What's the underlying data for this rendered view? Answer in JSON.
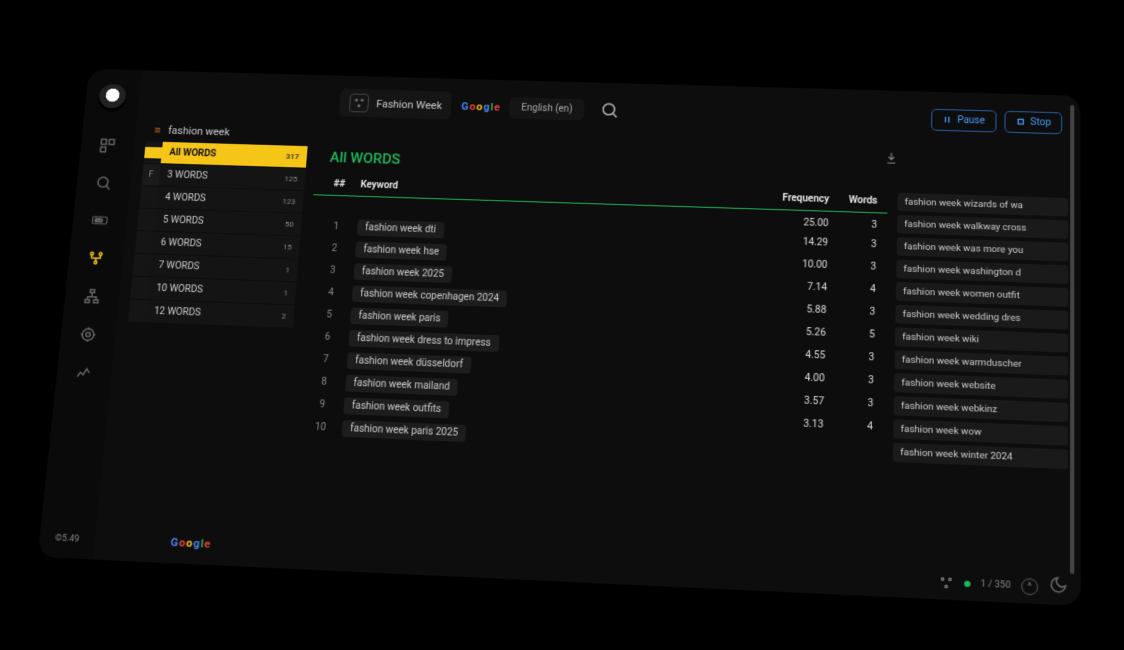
{
  "credits": "©5.49",
  "seed_keyword": "Fashion Week",
  "language": "English (en)",
  "controls": {
    "pause": "Pause",
    "stop": "Stop"
  },
  "breadcrumb": "fashion week",
  "filters": [
    {
      "label": "All WORDS",
      "count": "317",
      "active": true
    },
    {
      "label": "3 WORDS",
      "count": "125"
    },
    {
      "label": "4 WORDS",
      "count": "123"
    },
    {
      "label": "5 WORDS",
      "count": "50"
    },
    {
      "label": "6 WORDS",
      "count": "15"
    },
    {
      "label": "7 WORDS",
      "count": "1"
    },
    {
      "label": "10 WORDS",
      "count": "1"
    },
    {
      "label": "12 WORDS",
      "count": "2"
    }
  ],
  "filter_prefix": "F",
  "section_title": "All WORDS",
  "headers": {
    "idx": "##",
    "keyword": "Keyword",
    "freq": "Frequency",
    "words": "Words"
  },
  "rows": [
    {
      "idx": "",
      "kw": "",
      "freq": "25.00",
      "words": "3"
    },
    {
      "idx": "1",
      "kw": "fashion week dti",
      "freq": "14.29",
      "words": "3"
    },
    {
      "idx": "2",
      "kw": "fashion week hse",
      "freq": "10.00",
      "words": "3"
    },
    {
      "idx": "3",
      "kw": "fashion week 2025",
      "freq": "7.14",
      "words": "4"
    },
    {
      "idx": "4",
      "kw": "fashion week copenhagen 2024",
      "freq": "5.88",
      "words": "3"
    },
    {
      "idx": "5",
      "kw": "fashion week paris",
      "freq": "5.26",
      "words": "5"
    },
    {
      "idx": "6",
      "kw": "fashion week dress to impress",
      "freq": "4.55",
      "words": "3"
    },
    {
      "idx": "7",
      "kw": "fashion week düsseldorf",
      "freq": "4.00",
      "words": "3"
    },
    {
      "idx": "8",
      "kw": "fashion week mailand",
      "freq": "3.57",
      "words": "3"
    },
    {
      "idx": "9",
      "kw": "fashion week outfits",
      "freq": "3.13",
      "words": "4"
    },
    {
      "idx": "10",
      "kw": "fashion week paris 2025",
      "freq": "",
      "words": ""
    }
  ],
  "stream": [
    "fashion week wizards of wa",
    "fashion week walkway cross",
    "fashion week was more you",
    "fashion week washington d",
    "fashion week women outfit",
    "fashion week wedding dres",
    "fashion week wiki",
    "fashion week warmduscher",
    "fashion week website",
    "fashion week webkinz",
    "fashion week wow",
    "fashion week winter 2024"
  ],
  "progress": "1 / 350",
  "google": [
    "G",
    "o",
    "o",
    "g",
    "l",
    "e"
  ]
}
